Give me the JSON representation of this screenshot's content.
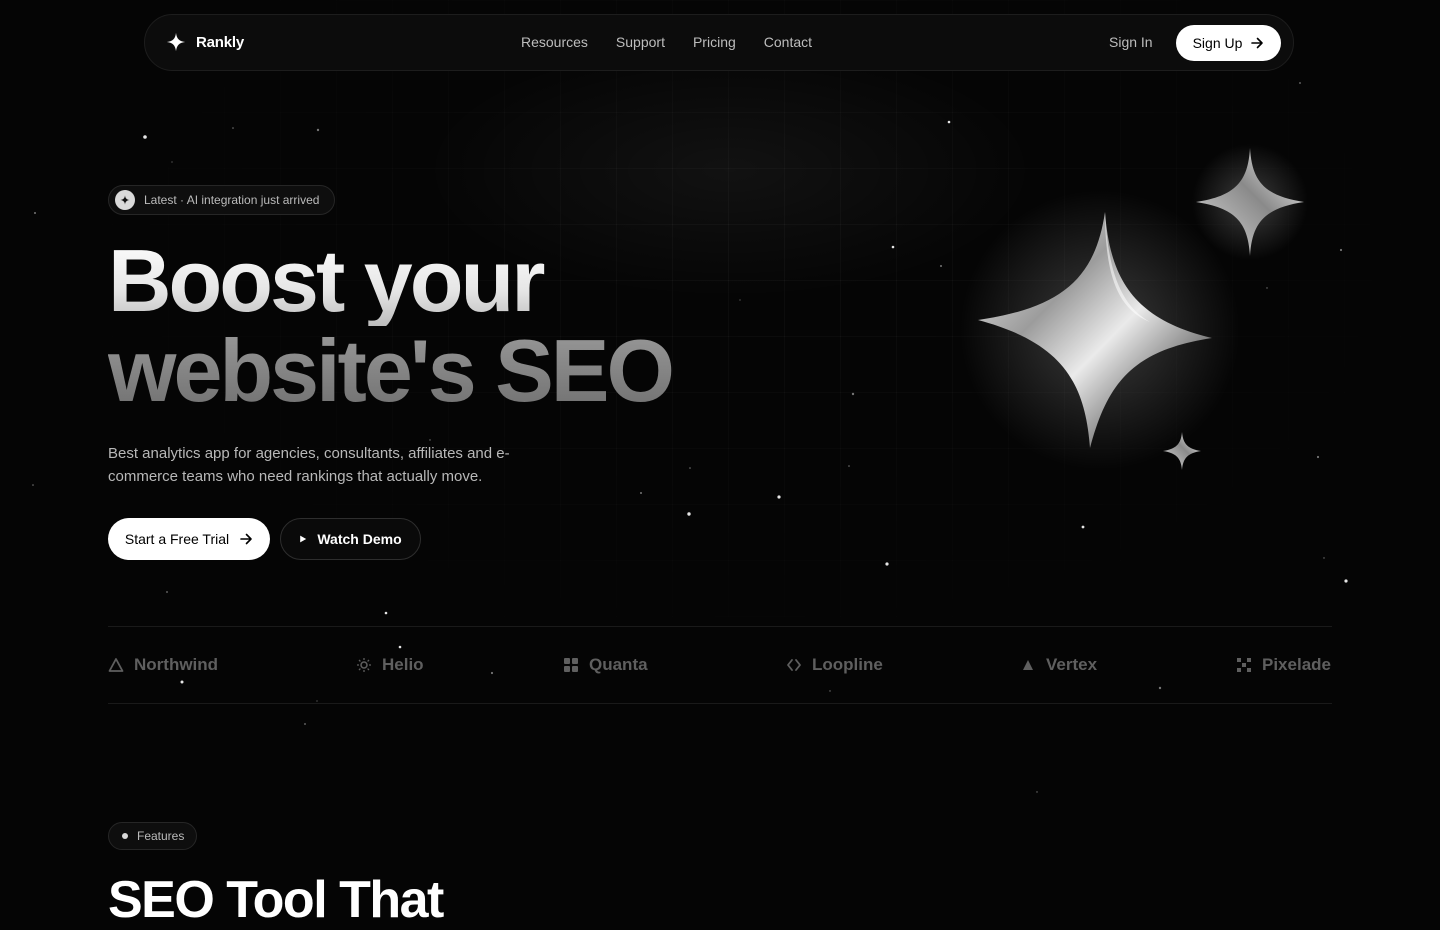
{
  "nav": {
    "brand": "Rankly",
    "links": [
      "Resources",
      "Support",
      "Pricing",
      "Contact"
    ],
    "sign_in": "Sign In",
    "sign_up": "Sign Up"
  },
  "hero": {
    "badge": "Latest · AI integration just arrived",
    "title_line1": "Boost your",
    "title_line2": "website's SEO",
    "subtitle": "Best analytics app for agencies, consultants, affiliates and e-commerce teams who need rankings that actually move.",
    "cta_primary": "Start a Free Trial",
    "cta_secondary": "Watch Demo"
  },
  "logos": [
    {
      "name": "Northwind",
      "icon": "triangle-outline-icon"
    },
    {
      "name": "Helio",
      "icon": "sun-icon"
    },
    {
      "name": "Quanta",
      "icon": "four-squares-icon"
    },
    {
      "name": "Loopline",
      "icon": "loop-icon"
    },
    {
      "name": "Vertex",
      "icon": "triangle-filled-icon"
    },
    {
      "name": "Pixelade",
      "icon": "pixel-cross-icon"
    }
  ],
  "features": {
    "pill": "Features",
    "heading": "SEO Tool That"
  },
  "colors": {
    "background": "#050505",
    "primary_button": "#ffffff",
    "muted_text": "#b8b8b8",
    "logo_gray": "#5f5f5f"
  }
}
